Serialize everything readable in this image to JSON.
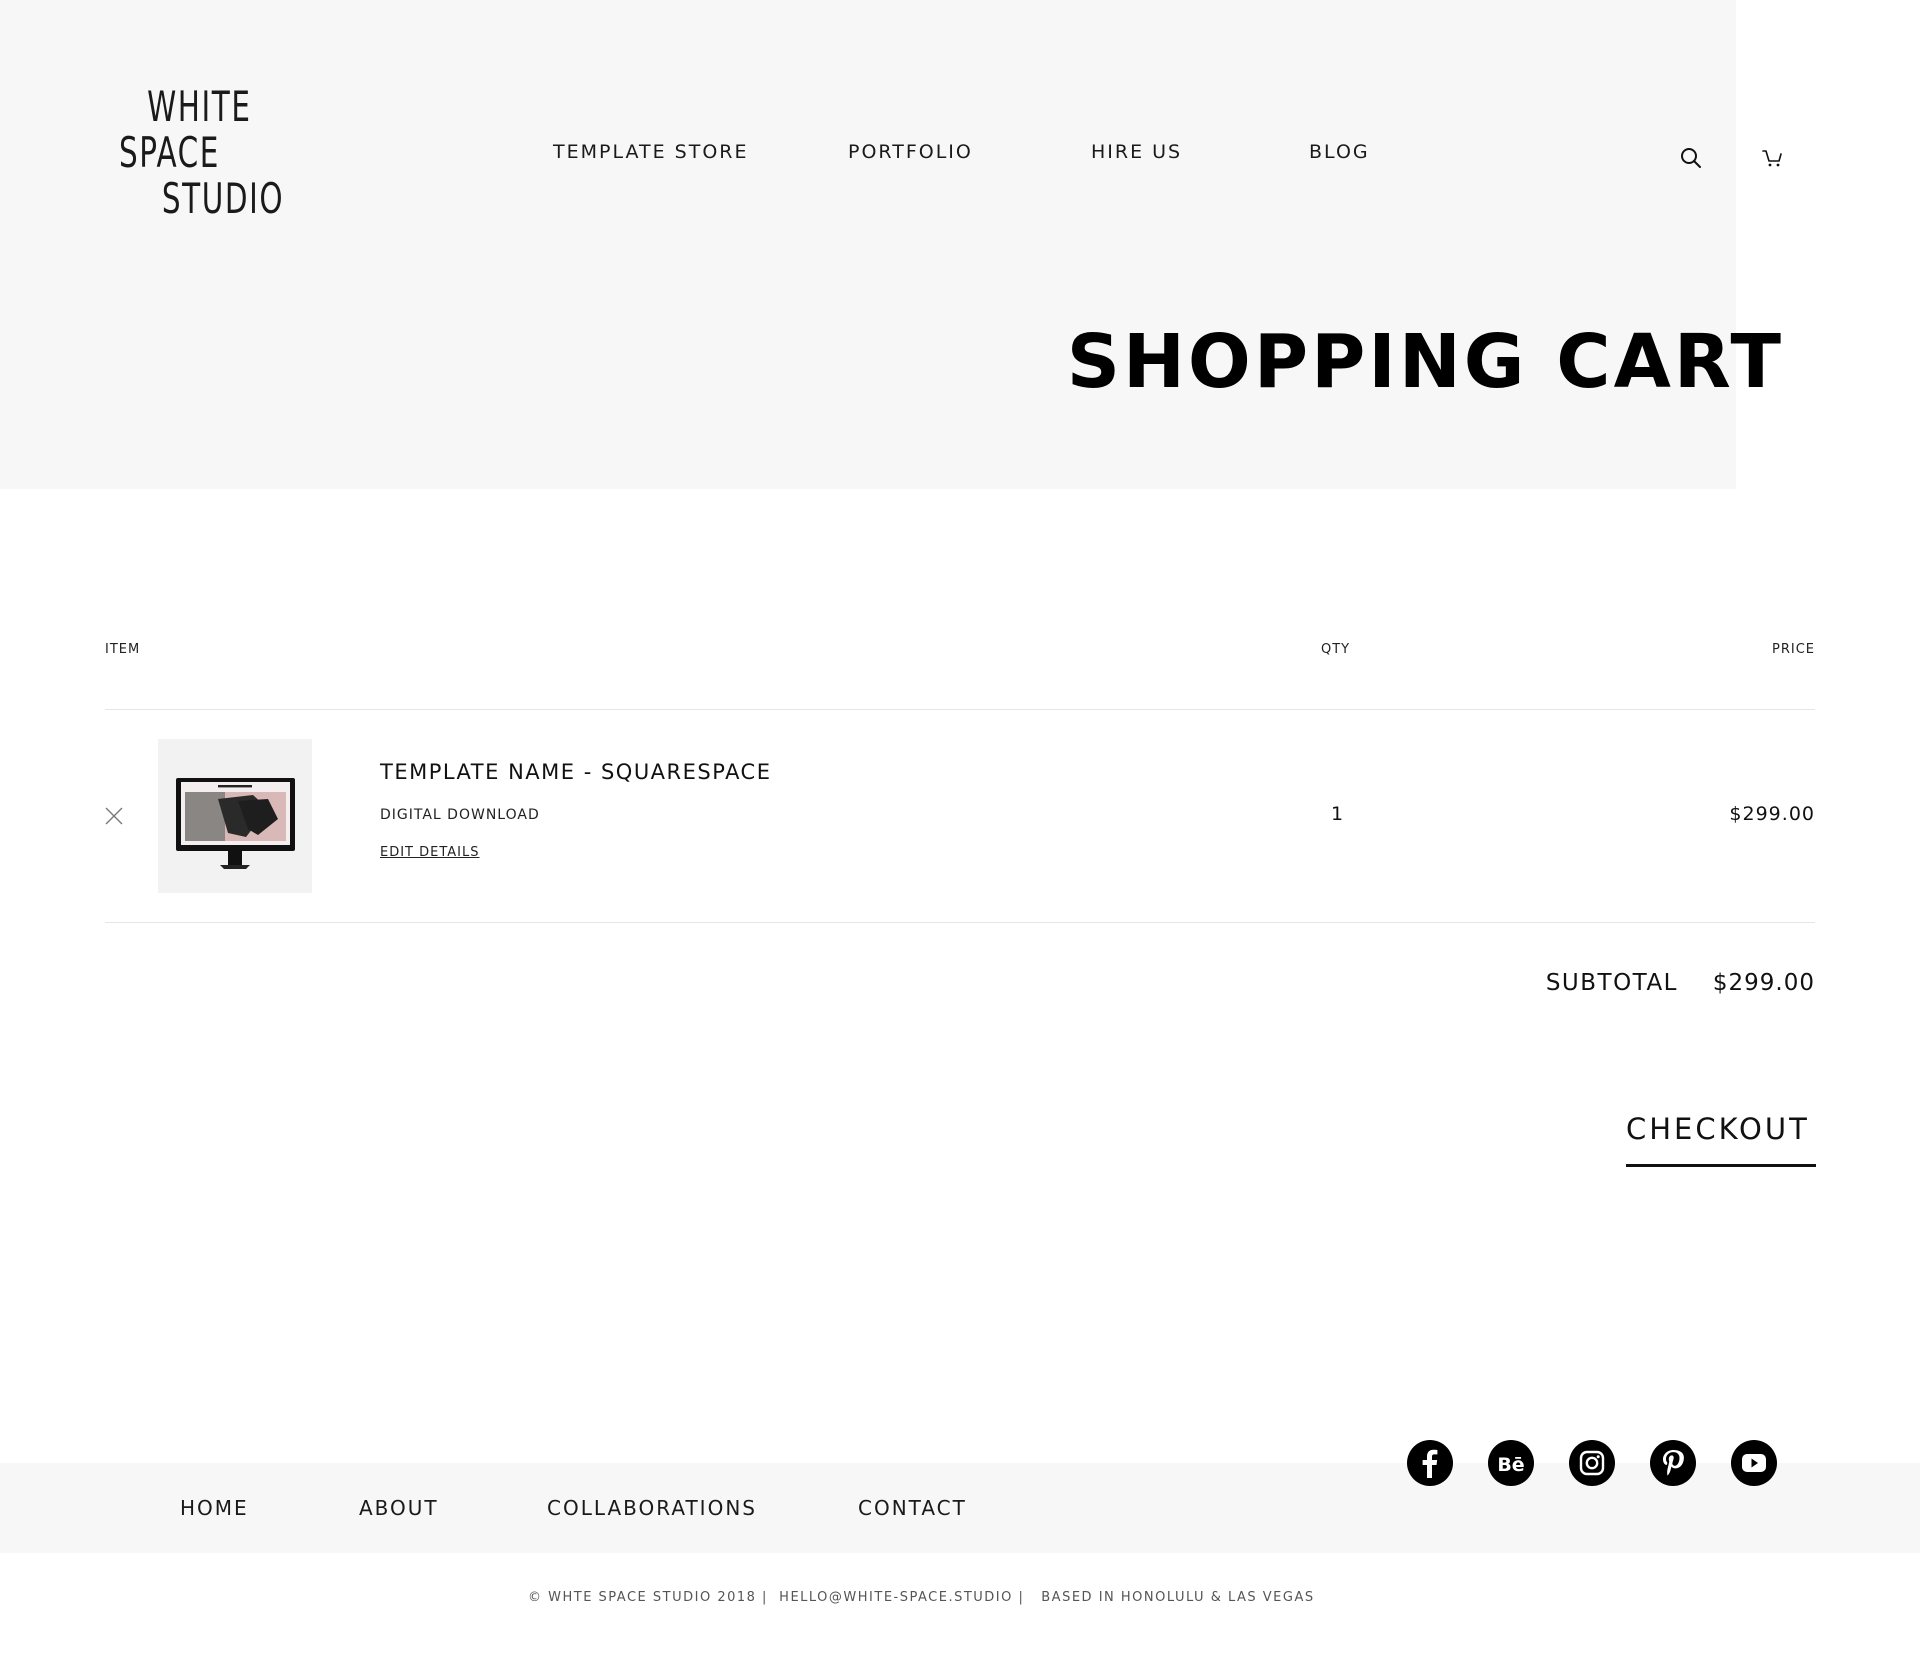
{
  "header": {
    "logo_lines": [
      "WHITE",
      "SPACE",
      "STUDIO"
    ],
    "nav": [
      "TEMPLATE STORE",
      "PORTFOLIO",
      "HIRE US",
      "BLOG"
    ],
    "icons": [
      "search-icon",
      "cart-icon"
    ]
  },
  "page_title": "SHOPPING CART",
  "cart": {
    "columns": [
      "ITEM",
      "QTY",
      "PRICE"
    ],
    "items": [
      {
        "name": "TEMPLATE NAME - SQUARESPACE",
        "type": "DIGITAL DOWNLOAD",
        "edit_label": "EDIT DETAILS",
        "qty": "1",
        "price": "$299.00"
      }
    ],
    "subtotal_label": "SUBTOTAL",
    "subtotal_value": "$299.00",
    "checkout_label": "CHECKOUT"
  },
  "footer": {
    "nav": [
      "HOME",
      "ABOUT",
      "COLLABORATIONS",
      "CONTACT"
    ],
    "social_icons": [
      "facebook-icon",
      "behance-icon",
      "instagram-icon",
      "pinterest-icon",
      "youtube-icon"
    ],
    "copyright": "© WHTE SPACE STUDIO 2018 |  HELLO@WHITE-SPACE.STUDIO |   BASED IN HONOLULU & LAS VEGAS"
  }
}
